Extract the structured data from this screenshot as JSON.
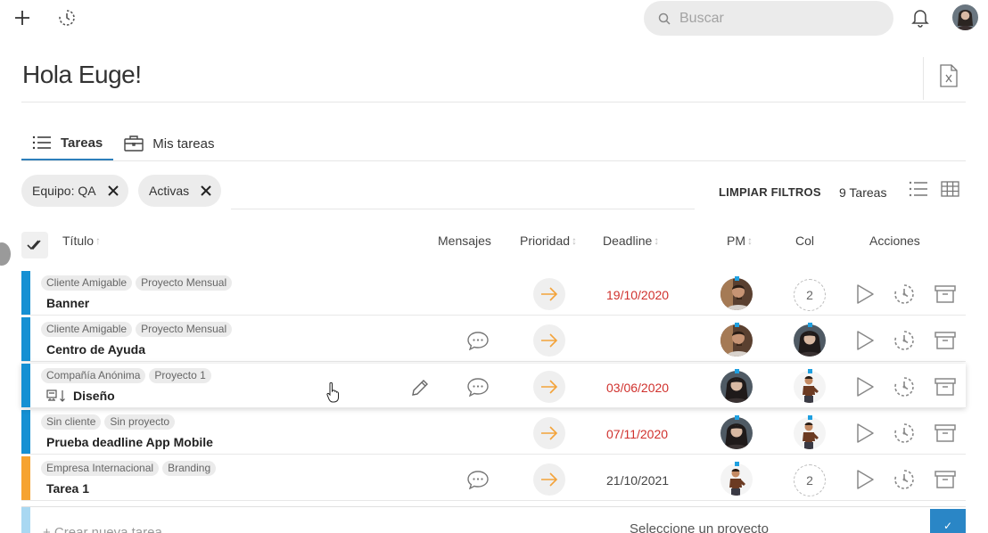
{
  "topbar": {
    "search_placeholder": "Buscar"
  },
  "header": {
    "greeting": "Hola Euge!"
  },
  "tabs": [
    {
      "label": "Tareas",
      "active": true
    },
    {
      "label": "Mis tareas",
      "active": false
    }
  ],
  "filters": {
    "chips": [
      {
        "label": "Equipo: QA"
      },
      {
        "label": "Activas"
      }
    ],
    "clear_label": "LIMPIAR FILTROS",
    "count_label": "9 Tareas"
  },
  "columns": {
    "title": "Título",
    "messages": "Mensajes",
    "priority": "Prioridad",
    "deadline": "Deadline",
    "pm": "PM",
    "col": "Col",
    "actions": "Acciones"
  },
  "colors": {
    "bar_blue": "#1590d3",
    "bar_orange": "#f6a330",
    "accent": "#2a86c6",
    "overdue": "#d0312d",
    "prio_arrow": "#f3a33a"
  },
  "tasks": [
    {
      "tags": [
        "Cliente Amigable",
        "Proyecto Mensual"
      ],
      "title": "Banner",
      "has_messages": false,
      "deadline": "19/10/2020",
      "overdue": true,
      "pm": "man",
      "col_count": "2",
      "bar": "blue"
    },
    {
      "tags": [
        "Cliente Amigable",
        "Proyecto Mensual"
      ],
      "title": "Centro de Ayuda",
      "has_messages": true,
      "deadline": "",
      "overdue": false,
      "pm": "man",
      "col_avatar": "woman",
      "bar": "blue"
    },
    {
      "tags": [
        "Compañía Anónima",
        "Proyecto 1"
      ],
      "title": "Diseño",
      "has_messages": true,
      "deadline": "03/06/2020",
      "overdue": true,
      "pm": "woman",
      "col_avatar": "figure",
      "bar": "blue",
      "hover": true
    },
    {
      "tags": [
        "Sin cliente",
        "Sin proyecto"
      ],
      "title": "Prueba deadline App Mobile",
      "has_messages": false,
      "deadline": "07/11/2020",
      "overdue": true,
      "pm": "woman",
      "col_avatar": "figure",
      "bar": "blue"
    },
    {
      "tags": [
        "Empresa Internacional",
        "Branding"
      ],
      "title": "Tarea 1",
      "has_messages": true,
      "deadline": "21/10/2021",
      "overdue": false,
      "pm": "figure",
      "col_count": "2",
      "bar": "orange"
    }
  ],
  "new_task": {
    "placeholder": "+ Crear nueva tarea",
    "project_placeholder": "Seleccione un proyecto",
    "confirm_label": "✓"
  }
}
